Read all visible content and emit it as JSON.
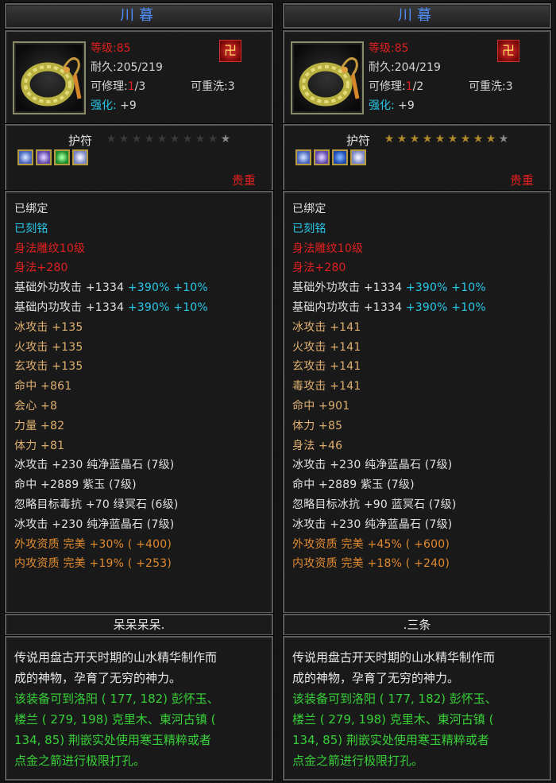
{
  "panels": [
    {
      "title": "川暮",
      "level": "等级:85",
      "durability": "耐久:205/219",
      "repair_label": "可修理:",
      "repair_cur": "1",
      "repair_max": "/3",
      "rewash": "可重洗:3",
      "enhance_label": "强化:",
      "enhance_value": "+9",
      "category": "护符",
      "stars_on": 0,
      "stars_total": 9,
      "gems": [
        "blue-gem-icon",
        "purple-gem-icon",
        "green-gem-icon",
        "blue-gem-icon"
      ],
      "gem_colors": [
        "blue",
        "purple",
        "green",
        "light"
      ],
      "precious": "贵重",
      "stats": [
        {
          "text": "已绑定",
          "color": "white"
        },
        {
          "text": "已刻铭",
          "color": "cyan"
        },
        {
          "text": "身法雕纹10级",
          "color": "red"
        },
        {
          "text": "身法+280",
          "color": "red"
        },
        {
          "text": "基础外功攻击 +1334",
          "extra": " +390% +10%",
          "color": "white"
        },
        {
          "text": "基础内功攻击 +1334",
          "extra": " +390% +10%",
          "color": "white"
        },
        {
          "text": "冰攻击 +135",
          "color": "gold"
        },
        {
          "text": "火攻击 +135",
          "color": "gold"
        },
        {
          "text": "玄攻击 +135",
          "color": "gold"
        },
        {
          "text": "命中 +861",
          "color": "gold"
        },
        {
          "text": "会心 +8",
          "color": "gold"
        },
        {
          "text": "力量 +82",
          "color": "gold"
        },
        {
          "text": "体力 +81",
          "color": "gold"
        },
        {
          "text": "冰攻击 +230 纯净蓝晶石 (7级)",
          "color": "white"
        },
        {
          "text": "命中 +2889 紫玉 (7级)",
          "color": "white"
        },
        {
          "text": "忽略目标毒抗 +70 绿冥石 (6级)",
          "color": "white"
        },
        {
          "text": "冰攻击 +230 纯净蓝晶石 (7级)",
          "color": "white"
        },
        {
          "text": "外攻资质  完美 +30% ( +400)",
          "color": "orange"
        },
        {
          "text": "内攻资质  完美 +19% ( +253)",
          "color": "orange"
        }
      ],
      "owner": "呆呆呆呆.",
      "desc": [
        {
          "text": "传说用盘古开天时期的山水精华制作而",
          "color": "white"
        },
        {
          "text": "成的神物，孕育了无穷的神力。",
          "color": "white"
        },
        {
          "text": "该装备可到洛阳 ( 177, 182) 彭怀玉、",
          "color": "green"
        },
        {
          "text": "楼兰 ( 279, 198) 克里木、東河古镇 (",
          "color": "green"
        },
        {
          "text": "134, 85) 荆嵌实处使用寒玉精粹或者",
          "color": "green"
        },
        {
          "text": "点金之箭进行极限打孔。",
          "color": "green"
        }
      ]
    },
    {
      "title": "川暮",
      "level": "等级:85",
      "durability": "耐久:204/219",
      "repair_label": "可修理:",
      "repair_cur": "1",
      "repair_max": "/2",
      "rewash": "可重洗:3",
      "enhance_label": "强化:",
      "enhance_value": "+9",
      "category": "护符",
      "stars_on": 9,
      "stars_total": 9,
      "gems": [
        "blue-gem-icon",
        "purple-gem-icon",
        "blue-gem-icon",
        "blue-gem-icon"
      ],
      "gem_colors": [
        "blue",
        "purple",
        "deep",
        "light"
      ],
      "precious": "贵重",
      "stats": [
        {
          "text": "已绑定",
          "color": "white"
        },
        {
          "text": "已刻铭",
          "color": "cyan"
        },
        {
          "text": "身法雕纹10级",
          "color": "red"
        },
        {
          "text": "身法+280",
          "color": "red"
        },
        {
          "text": "基础外功攻击 +1334",
          "extra": " +390% +10%",
          "color": "white"
        },
        {
          "text": "基础内功攻击 +1334",
          "extra": " +390% +10%",
          "color": "white"
        },
        {
          "text": "冰攻击 +141",
          "color": "gold"
        },
        {
          "text": "火攻击 +141",
          "color": "gold"
        },
        {
          "text": "玄攻击 +141",
          "color": "gold"
        },
        {
          "text": "毒攻击 +141",
          "color": "gold"
        },
        {
          "text": "命中 +901",
          "color": "gold"
        },
        {
          "text": "体力 +85",
          "color": "gold"
        },
        {
          "text": "身法 +46",
          "color": "gold"
        },
        {
          "text": "冰攻击 +230 纯净蓝晶石 (7级)",
          "color": "white"
        },
        {
          "text": "命中 +2889 紫玉 (7级)",
          "color": "white"
        },
        {
          "text": "忽略目标冰抗 +90 蓝冥石 (7级)",
          "color": "white"
        },
        {
          "text": "冰攻击 +230 纯净蓝晶石 (7级)",
          "color": "white"
        },
        {
          "text": "外攻资质  完美 +45% ( +600)",
          "color": "orange"
        },
        {
          "text": "内攻资质  完美 +18% ( +240)",
          "color": "orange"
        }
      ],
      "owner": ".三条",
      "desc": [
        {
          "text": "传说用盘古开天时期的山水精华制作而",
          "color": "white"
        },
        {
          "text": "成的神物，孕育了无穷的神力。",
          "color": "white"
        },
        {
          "text": "该装备可到洛阳 ( 177, 182) 彭怀玉、",
          "color": "green"
        },
        {
          "text": "楼兰 ( 279, 198) 克里木、東河古镇 (",
          "color": "green"
        },
        {
          "text": "134, 85) 荆嵌实处使用寒玉精粹或者",
          "color": "green"
        },
        {
          "text": "点金之箭进行极限打孔。",
          "color": "green"
        }
      ]
    }
  ]
}
